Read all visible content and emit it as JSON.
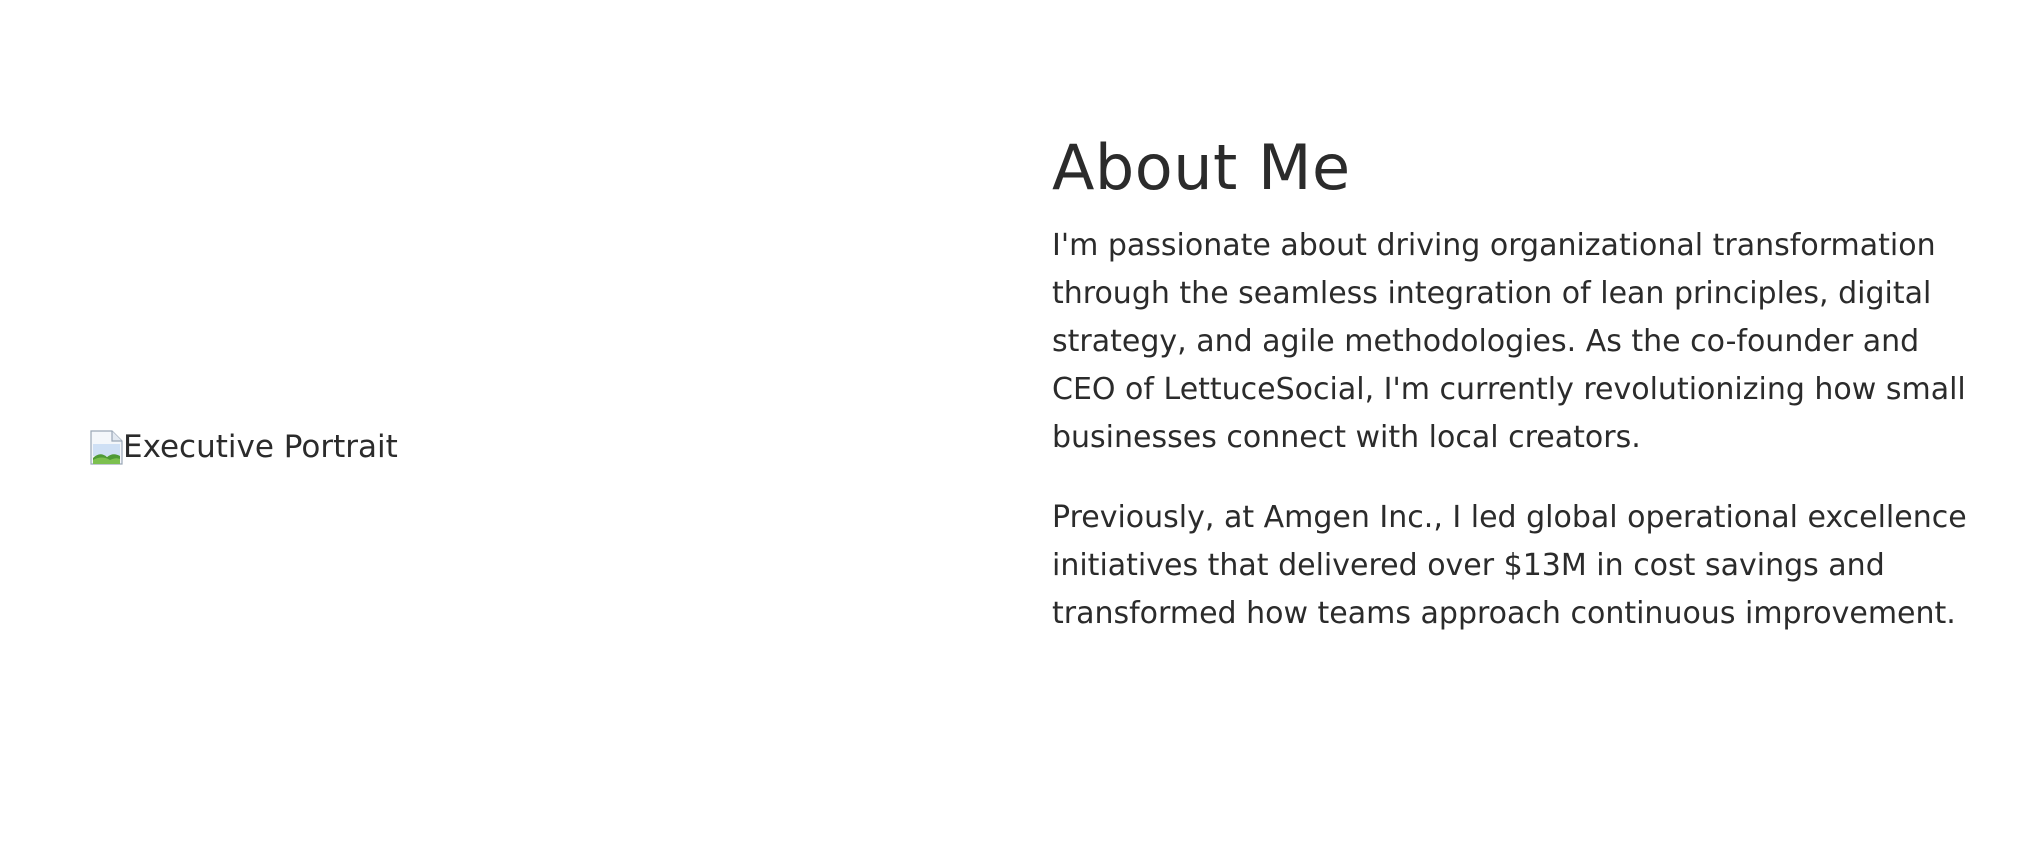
{
  "portrait": {
    "alt_text": "Executive Portrait",
    "icon": "broken-image-icon"
  },
  "about": {
    "title": "About Me",
    "paragraphs": [
      "I'm passionate about driving organizational transformation through the seamless integration of lean principles, digital strategy, and agile methodologies. As the co-founder and CEO of LettuceSocial, I'm currently revolutionizing how small businesses connect with local creators.",
      "Previously, at Amgen Inc., I led global operational excellence initiatives that delivered over $13M in cost savings and transformed how teams approach continuous improvement."
    ]
  },
  "colors": {
    "text": "#2b2b2b",
    "background": "#ffffff"
  }
}
